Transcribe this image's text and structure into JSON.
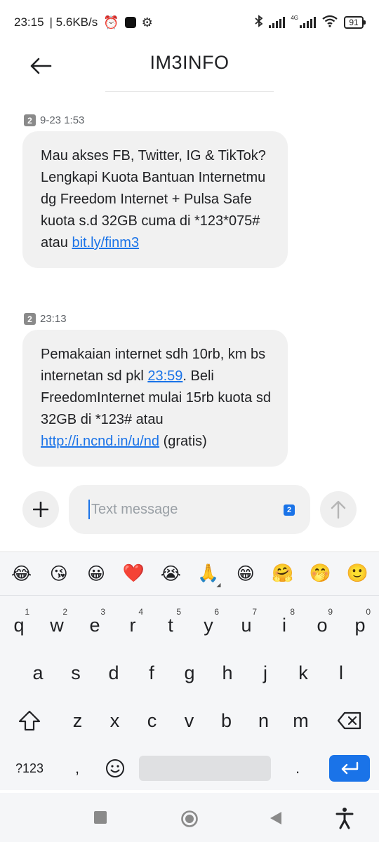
{
  "status_bar": {
    "time": "23:15",
    "speed": "| 5.6KB/s",
    "network_tag": "4G",
    "battery": "91"
  },
  "header": {
    "title": "IM3INFO"
  },
  "messages": [
    {
      "sim": "2",
      "timestamp": "9-23 1:53",
      "text_parts": [
        {
          "t": "Mau akses FB, Twitter, IG & TikTok? Lengkapi Kuota Bantuan Internetmu dg Freedom Internet + Pulsa Safe kuota s.d 32GB cuma di *123*075# atau "
        },
        {
          "t": "bit.ly/finm3",
          "link": true
        }
      ]
    },
    {
      "sim": "2",
      "timestamp": "23:13",
      "text_parts": [
        {
          "t": "Pemakaian internet sdh 10rb, km bs internetan sd pkl "
        },
        {
          "t": "23:59",
          "link": true
        },
        {
          "t": ". Beli FreedomInternet mulai 15rb kuota sd 32GB di *123# atau "
        },
        {
          "t": "http://i.ncnd.in/u/nd",
          "link": true
        },
        {
          "t": " (gratis)"
        }
      ]
    }
  ],
  "compose": {
    "placeholder": "Text message",
    "sim": "2"
  },
  "keyboard": {
    "emojis": [
      "😂",
      "😘",
      "😀",
      "❤️",
      "😭",
      "🙏",
      "😁",
      "🤗",
      "🤭",
      "🙂"
    ],
    "row1": [
      {
        "k": "q",
        "n": "1"
      },
      {
        "k": "w",
        "n": "2"
      },
      {
        "k": "e",
        "n": "3"
      },
      {
        "k": "r",
        "n": "4"
      },
      {
        "k": "t",
        "n": "5"
      },
      {
        "k": "y",
        "n": "6"
      },
      {
        "k": "u",
        "n": "7"
      },
      {
        "k": "i",
        "n": "8"
      },
      {
        "k": "o",
        "n": "9"
      },
      {
        "k": "p",
        "n": "0"
      }
    ],
    "row2": [
      "a",
      "s",
      "d",
      "f",
      "g",
      "h",
      "j",
      "k",
      "l"
    ],
    "row3": [
      "z",
      "x",
      "c",
      "v",
      "b",
      "n",
      "m"
    ],
    "symbols_label": "?123",
    "comma": ",",
    "period": "."
  },
  "colors": {
    "accent": "#1a73e8",
    "bubble": "#f1f1f1"
  }
}
